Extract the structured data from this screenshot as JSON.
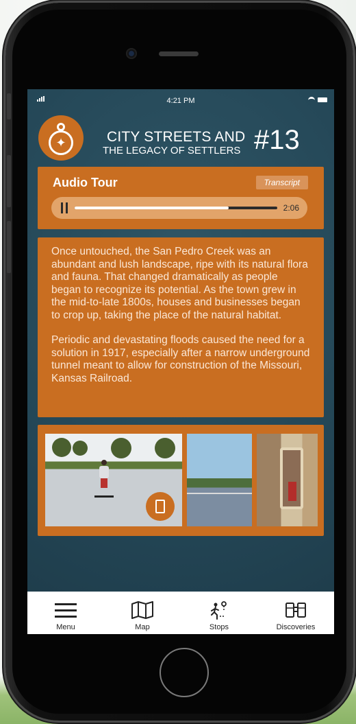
{
  "status_bar": {
    "time": "4:21 PM"
  },
  "header": {
    "title_line1": "CITY STREETS AND",
    "title_line2": "THE LEGACY OF SETTLERS",
    "stop_number": "#13"
  },
  "audio": {
    "title": "Audio Tour",
    "transcript_label": "Transcript",
    "duration": "2:06",
    "progress_fraction": 0.76
  },
  "story": {
    "paragraphs": [
      "Once untouched, the San Pedro Creek was an abundant and lush landscape, ripe with its natural flora and fauna. That changed dramatically as people began to recognize its potential. As the town grew in the mid-to-late 1800s, houses and businesses began to crop up, taking the place of the natural habitat.",
      "Periodic and devastating floods caused the need for a solution in 1917, especially after a narrow underground tunnel meant to allow for construction of the Missouri, Kansas Railroad."
    ]
  },
  "tabs": [
    {
      "label": "Menu",
      "icon": "hamburger-icon"
    },
    {
      "label": "Map",
      "icon": "map-icon"
    },
    {
      "label": "Stops",
      "icon": "walking-route-icon"
    },
    {
      "label": "Discoveries",
      "icon": "binoculars-icon"
    }
  ],
  "colors": {
    "accent": "#c96e21",
    "screen_bg": "#2a4f5f",
    "tabbar_bg": "#ffffff"
  }
}
